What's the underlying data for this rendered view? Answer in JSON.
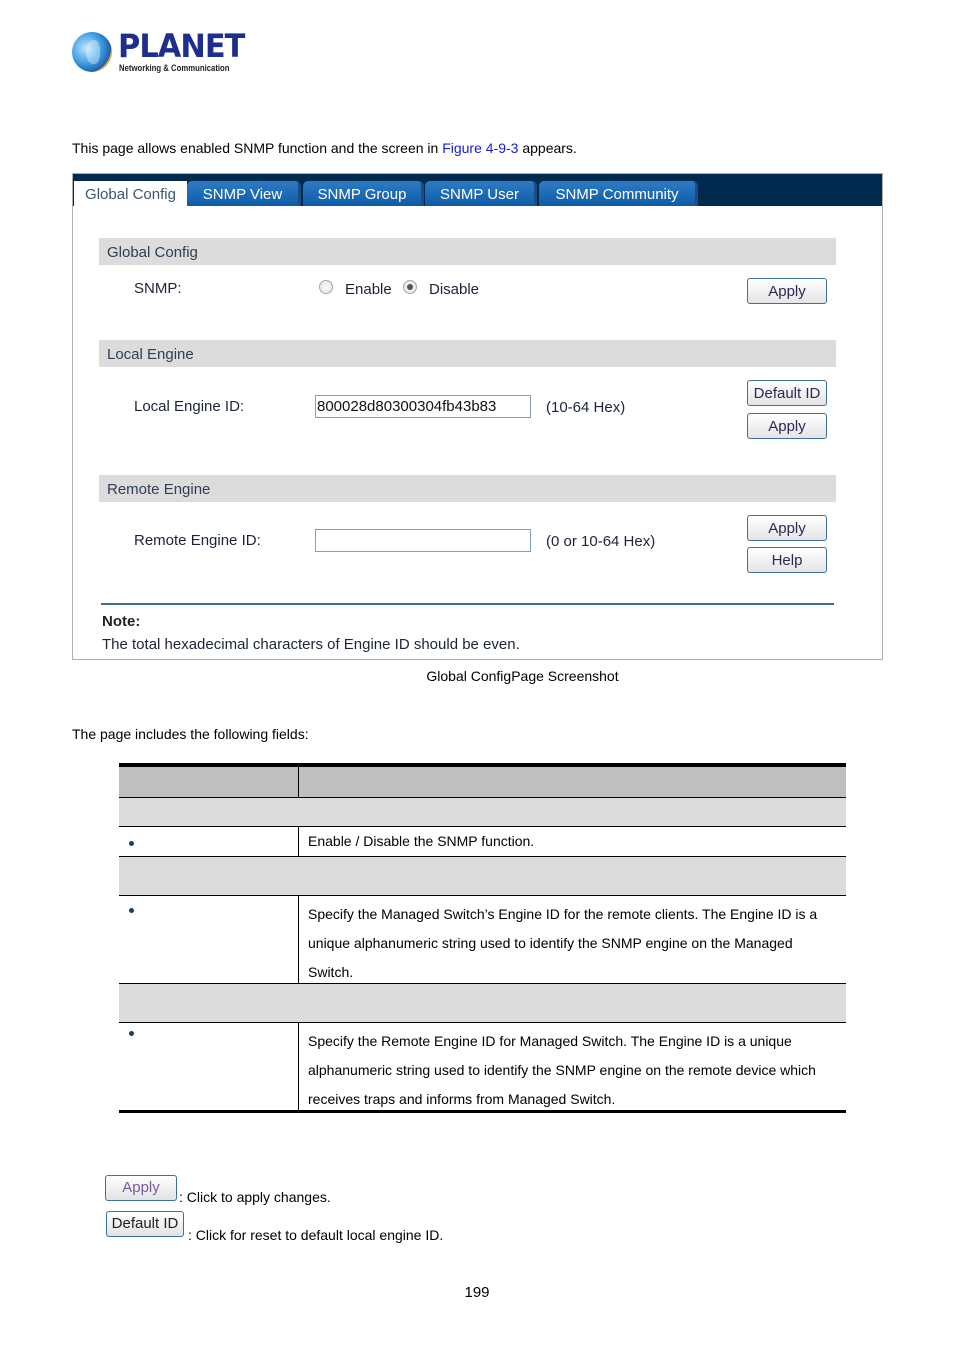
{
  "logo": {
    "brand": "PLANET",
    "tagline": "Networking & Communication"
  },
  "intro": {
    "text_before": "This page allows enabled SNMP function and the screen in ",
    "link": "Figure 4-9-3",
    "text_after": " appears."
  },
  "tabs": [
    {
      "label": "Global Config",
      "active": true
    },
    {
      "label": "SNMP View",
      "active": false
    },
    {
      "label": "SNMP Group",
      "active": false
    },
    {
      "label": "SNMP User",
      "active": false
    },
    {
      "label": "SNMP Community",
      "active": false
    }
  ],
  "global_config": {
    "title": "Global Config",
    "snmp_label": "SNMP:",
    "options": [
      {
        "label": "Enable",
        "checked": false
      },
      {
        "label": "Disable",
        "checked": true
      }
    ],
    "apply": "Apply"
  },
  "local_engine": {
    "title": "Local Engine",
    "id_label": "Local Engine ID:",
    "id_value": "800028d80300304fb43b83",
    "hint": "(10-64 Hex)",
    "default_button": "Default ID",
    "apply": "Apply"
  },
  "remote_engine": {
    "title": "Remote Engine",
    "id_label": "Remote Engine ID:",
    "id_value": "",
    "hint": "(0 or 10-64 Hex)",
    "apply": "Apply",
    "help": "Help"
  },
  "note": {
    "title": "Note:",
    "text": "The total hexadecimal characters of Engine ID should be even."
  },
  "caption": "Global ConfigPage Screenshot",
  "fields_intro": "The page includes the following fields:",
  "fields_table": {
    "rows": [
      {
        "type": "item",
        "description": "Enable / Disable the SNMP function."
      },
      {
        "type": "item",
        "description": "Specify the Managed Switch’s Engine ID for the remote clients. The Engine ID is a unique alphanumeric string used to identify the SNMP engine on the Managed Switch."
      },
      {
        "type": "item",
        "description": "Specify the Remote Engine ID for Managed Switch. The Engine ID is a unique alphanumeric string used to identify the SNMP engine on the remote device which receives traps and informs from Managed Switch."
      }
    ]
  },
  "buttons_legend": [
    {
      "button": "Apply",
      "text": ": Click to apply changes."
    },
    {
      "button": "Default ID",
      "text": ": Click for reset to default local engine ID."
    }
  ],
  "page_number": "199"
}
